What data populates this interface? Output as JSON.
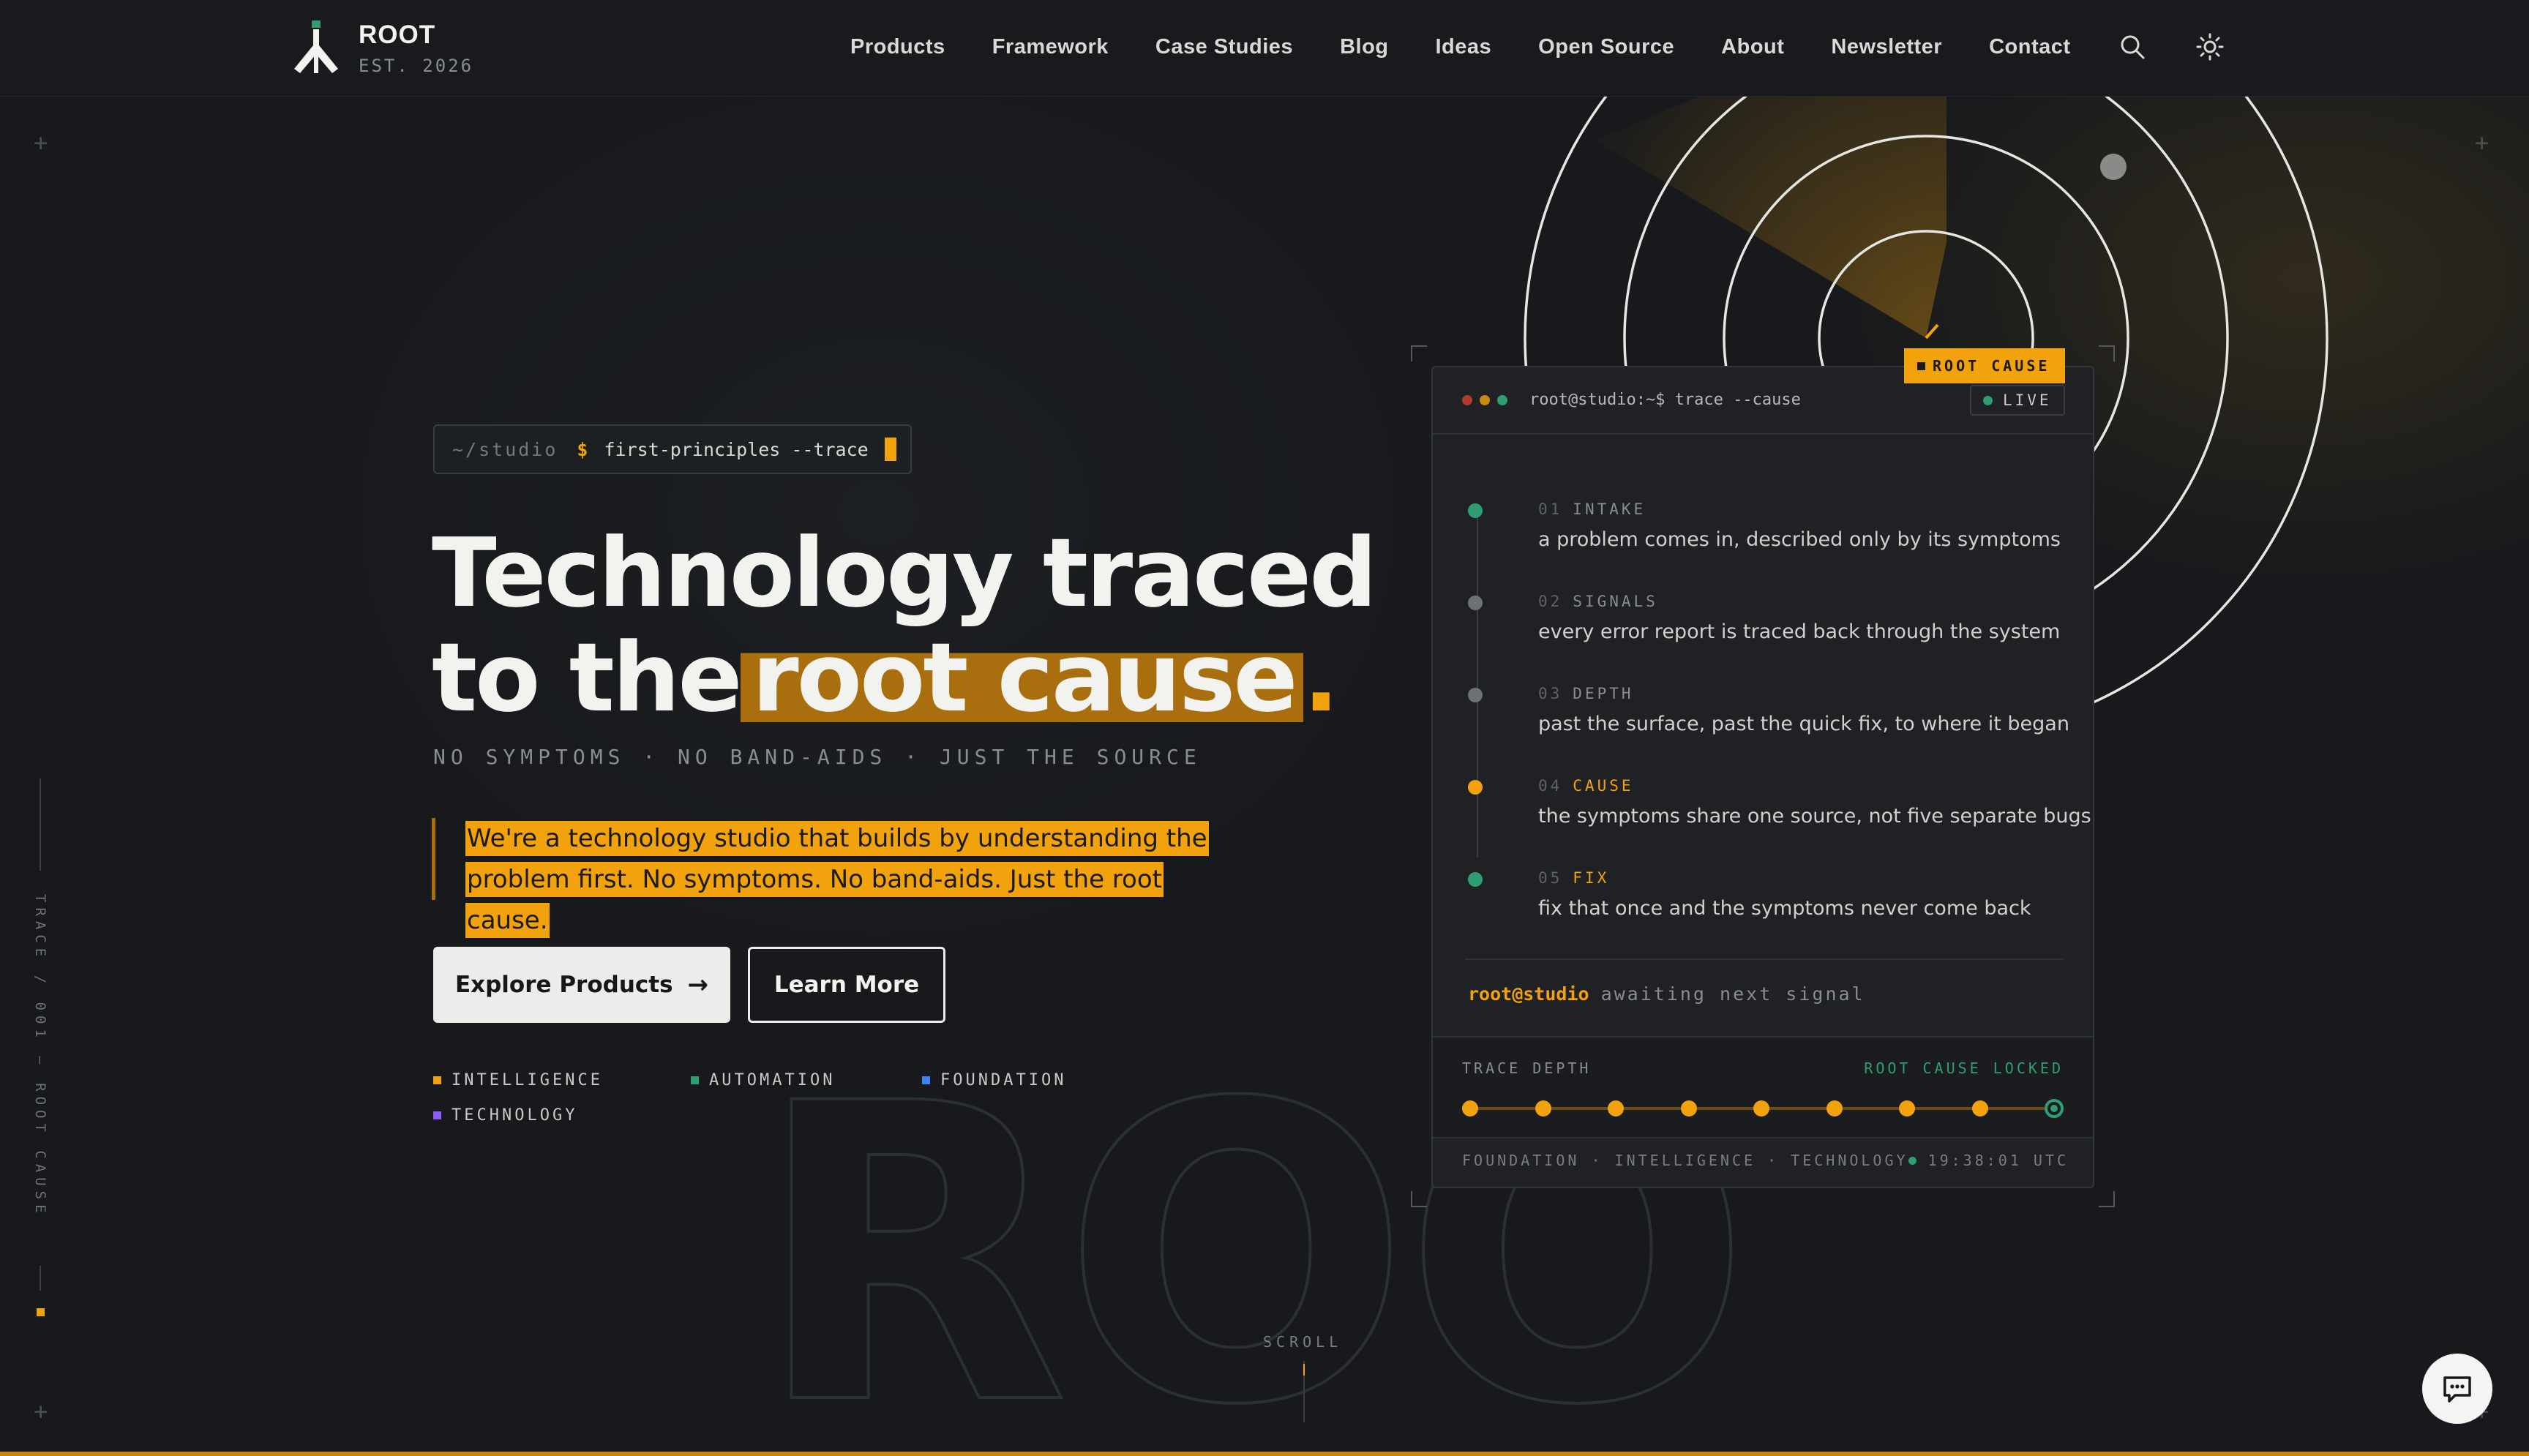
{
  "brand": {
    "name": "ROOT",
    "est": "EST. 2026"
  },
  "nav": {
    "items": [
      "Products",
      "Framework",
      "Case Studies",
      "Blog",
      "Ideas",
      "Open Source",
      "About",
      "Newsletter",
      "Contact"
    ],
    "icons": [
      "search-icon",
      "sun-icon"
    ]
  },
  "side_rail": {
    "text": "TRACE / 001 — ROOT CAUSE"
  },
  "hero": {
    "prompt": {
      "path": "~/studio",
      "symbol": "$",
      "command": "first-principles --trace"
    },
    "title_line1": "Technology traced",
    "title_line2_prefix": "to the",
    "title_highlight": "root cause",
    "title_period": ".",
    "tagline": "NO SYMPTOMS · NO BAND-AIDS · JUST THE SOURCE",
    "quote": "We're a technology studio that builds by understanding the problem first. No symptoms. No band-aids. Just the root cause.",
    "primary_button": "Explore Products",
    "primary_arrow": "→",
    "secondary_button": "Learn More",
    "pillars": [
      {
        "label": "INTELLIGENCE",
        "color": "#f2a20c"
      },
      {
        "label": "AUTOMATION",
        "color": "#2f9e73"
      },
      {
        "label": "FOUNDATION",
        "color": "#3b82f6"
      },
      {
        "label": "TECHNOLOGY",
        "color": "#8b5cf6"
      }
    ],
    "ghost_word": "ROOT",
    "scroll": "SCROLL"
  },
  "panel": {
    "tag": "ROOT CAUSE",
    "title": "root@studio:~$ trace --cause",
    "live": "LIVE",
    "steps": [
      {
        "num": "01",
        "label": "INTAKE",
        "desc": "a problem comes in, described only by its symptoms",
        "color": "#2f9e73"
      },
      {
        "num": "02",
        "label": "SIGNALS",
        "desc": "every error report is traced back through the system",
        "color": "#6e7175"
      },
      {
        "num": "03",
        "label": "DEPTH",
        "desc": "past the surface, past the quick fix, to where it began",
        "color": "#6e7175"
      },
      {
        "num": "04",
        "label": "CAUSE",
        "desc": "the symptoms share one source, not five separate bugs",
        "color": "#f2a20c"
      },
      {
        "num": "05",
        "label": "FIX",
        "desc": "fix that once and the symptoms never come back",
        "color": "#2f9e73"
      }
    ],
    "awaiting_user": "root@studio",
    "awaiting_text": "awaiting next signal",
    "trace_label": "TRACE DEPTH",
    "trace_status": "ROOT CAUSE LOCKED",
    "trace_steps_complete": 9,
    "footer": "FOUNDATION · INTELLIGENCE · TECHNOLOGY",
    "clock": "19:38:01 UTC"
  },
  "colors": {
    "accent": "#f2a20c",
    "success": "#2f9e73",
    "background": "#17191c"
  },
  "chat": {
    "icon": "chat-icon"
  }
}
